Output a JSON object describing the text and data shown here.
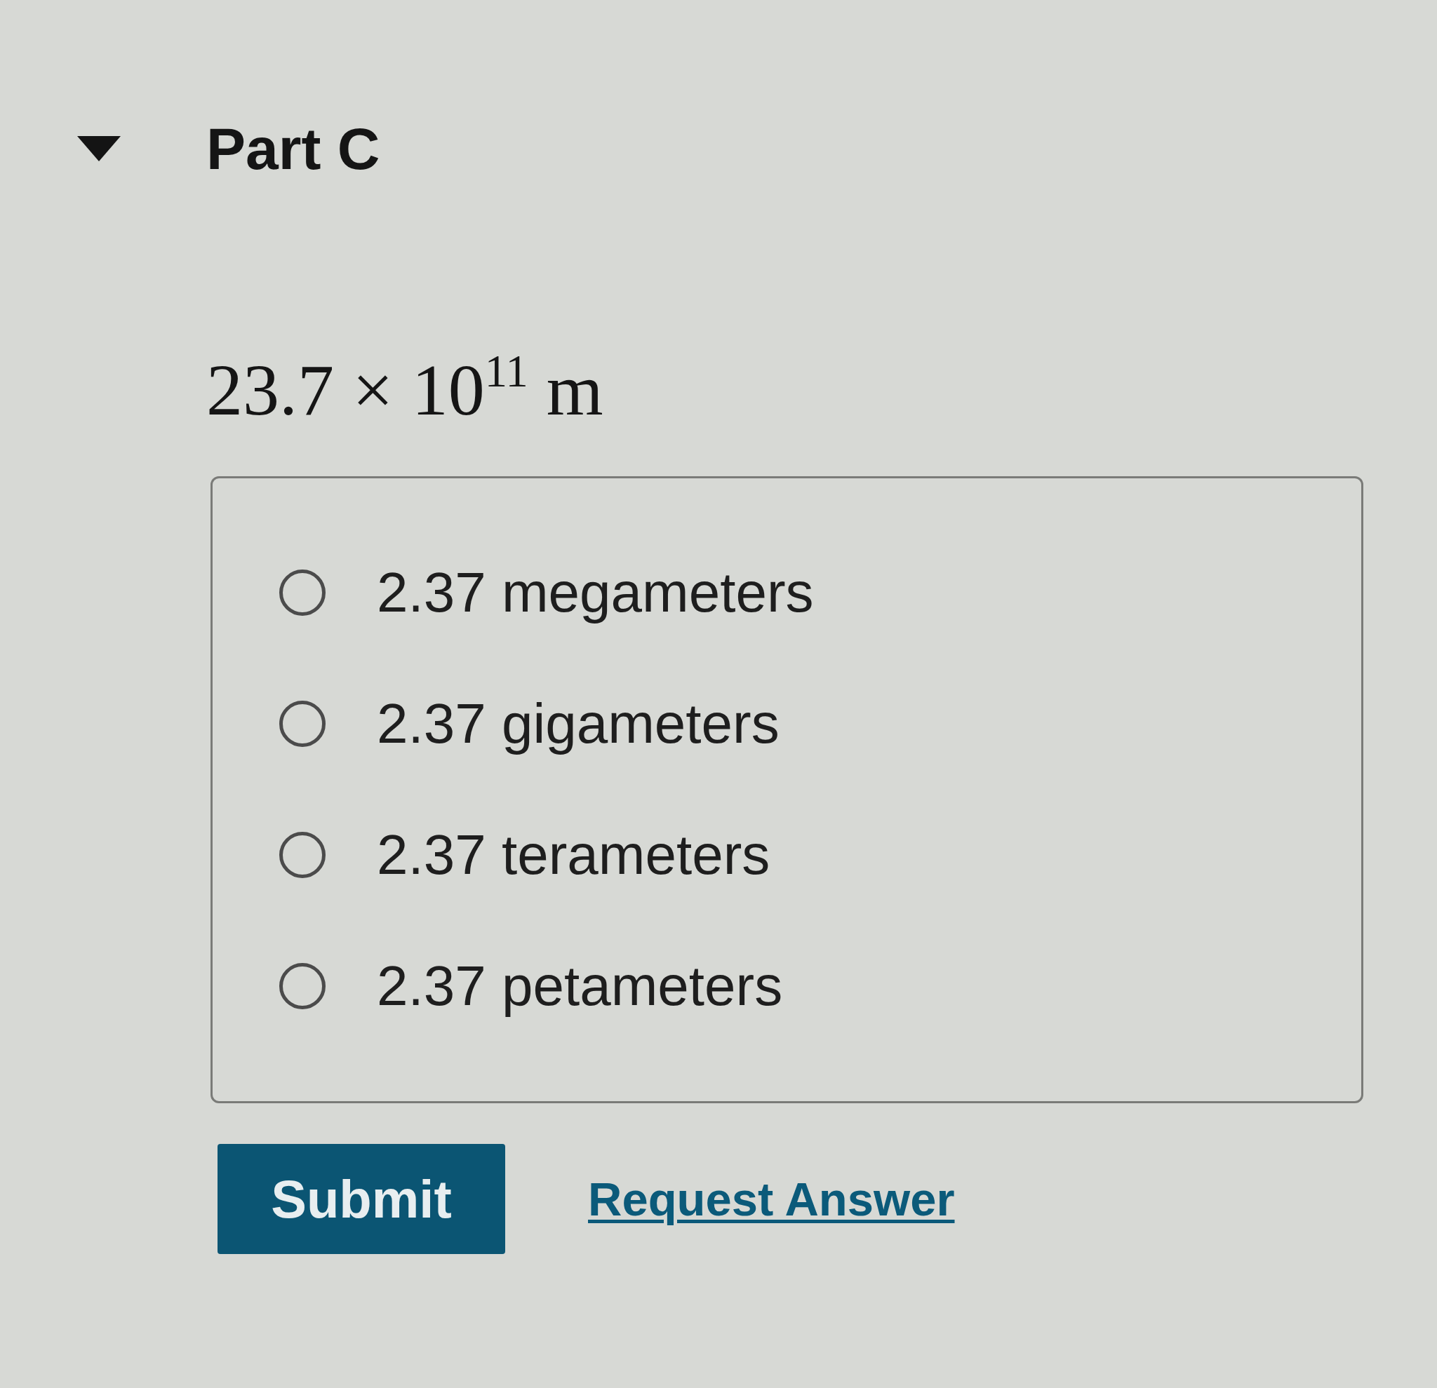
{
  "part": {
    "title": "Part C",
    "expanded": true
  },
  "question": {
    "expression": "23.7 × 10$^{11}$ m"
  },
  "choices": [
    {
      "label": "2.37 megameters",
      "selected": false
    },
    {
      "label": "2.37 gigameters",
      "selected": false
    },
    {
      "label": "2.37 terameters",
      "selected": false
    },
    {
      "label": "2.37 petameters",
      "selected": false
    }
  ],
  "actions": {
    "submit": "Submit",
    "request_answer": "Request Answer"
  }
}
